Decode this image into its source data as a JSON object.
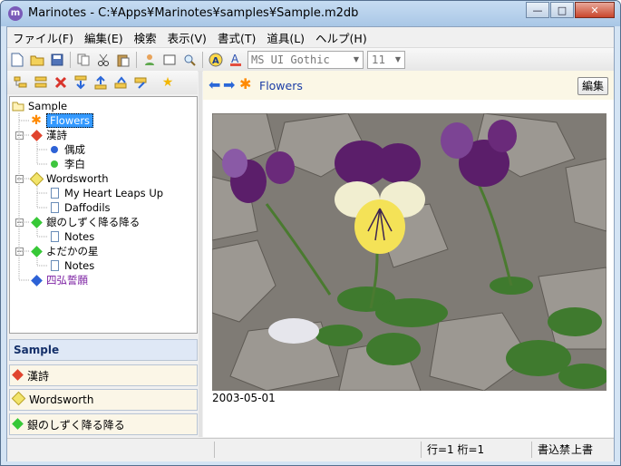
{
  "window": {
    "title": "Marinotes - C:¥Apps¥Marinotes¥samples¥Sample.m2db",
    "app_icon_letter": "m"
  },
  "window_buttons": {
    "minimize": "—",
    "maximize": "□",
    "close": "✕"
  },
  "menu": [
    "ファイル(F)",
    "編集(E)",
    "検索",
    "表示(V)",
    "書式(T)",
    "道具(L)",
    "ヘルプ(H)"
  ],
  "toolbar": {
    "font_name": "MS UI Gothic",
    "font_size": "11"
  },
  "tree": {
    "root": "Sample",
    "nodes": {
      "flowers": "Flowers",
      "kanshi": "漢詩",
      "gusei": "偶成",
      "rihaku": "李白",
      "wordsworth": "Wordsworth",
      "my_heart": "My Heart Leaps Up",
      "daffodils": "Daffodils",
      "gin": "銀のしずく降る降る",
      "gin_notes": "Notes",
      "yodaka": "よだかの星",
      "yodaka_notes": "Notes",
      "shigu": "四弘誓願"
    }
  },
  "sections": [
    "Sample",
    "漢詩",
    "Wordsworth",
    "銀のしずく降る降る"
  ],
  "right_header": {
    "title": "Flowers",
    "edit_label": "編集"
  },
  "content": {
    "caption": "2003-05-01"
  },
  "status": {
    "position": "行=1 桁=1",
    "write": "書込禁",
    "mode": "上書"
  },
  "colors": {
    "accent": "#2a67d8",
    "title_blue": "#1b3da6",
    "selection": "#3399ff"
  }
}
